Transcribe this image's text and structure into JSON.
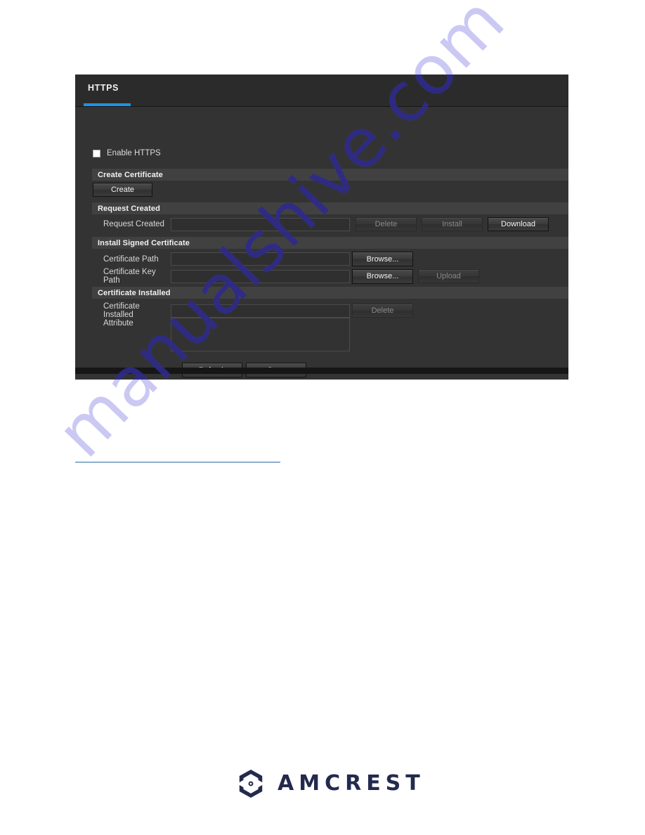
{
  "page": {
    "background_color": "#ffffff",
    "watermark": "manualshive.com"
  },
  "device_ui": {
    "tab": {
      "label": "HTTPS",
      "accent_color": "#1e94e0"
    },
    "enable_https": {
      "label": "Enable HTTPS",
      "checked": false
    },
    "sections": {
      "create_certificate": "Create Certificate",
      "request_created": "Request Created",
      "install_signed_certificate": "Install Signed Certificate",
      "certificate_installed": "Certificate Installed"
    },
    "buttons": {
      "create": "Create",
      "delete_request": "Delete",
      "install": "Install",
      "download": "Download",
      "browse_cert_path": "Browse...",
      "browse_cert_key_path": "Browse...",
      "upload": "Upload",
      "delete_installed": "Delete",
      "refresh": "Refresh",
      "save": "Save"
    },
    "labels": {
      "request_created": "Request Created",
      "certificate_path": "Certificate Path",
      "certificate_key_path": "Certificate Key Path",
      "certificate_installed": "Certificate Installed",
      "attribute": "Attribute"
    },
    "fields": {
      "request_created_value": "",
      "certificate_path_value": "",
      "certificate_key_path_value": "",
      "certificate_installed_value": "",
      "attribute_value": ""
    }
  },
  "footer": {
    "brand": "AMCREST",
    "mark_color": "#232a4e",
    "mark_dot_color": "#3a7fd5"
  }
}
